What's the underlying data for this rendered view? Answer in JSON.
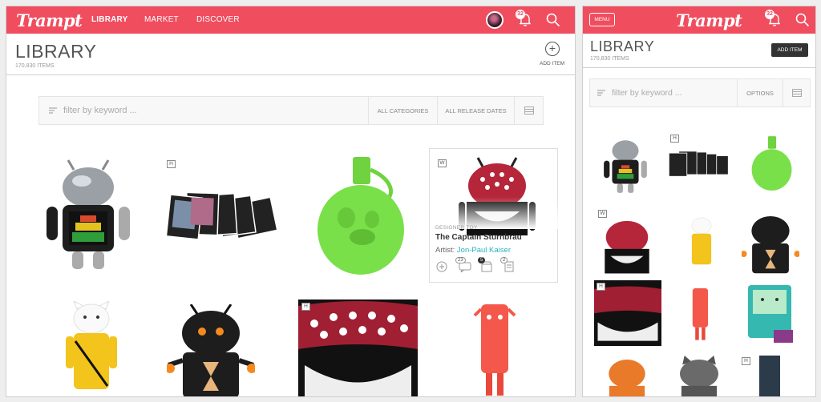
{
  "desktop": {
    "logo": "Trampt",
    "nav": [
      "LIBRARY",
      "MARKET",
      "DISCOVER"
    ],
    "notifications": "32",
    "title": "LIBRARY",
    "count": "170,830 ITEMS",
    "add_item": "ADD ITEM",
    "filter": {
      "placeholder": "filter by keyword ...",
      "categories": "ALL CATEGORIES",
      "dates": "ALL RELEASE DATES"
    },
    "tags": [
      "H",
      "W",
      "H"
    ],
    "card": {
      "category": "DESIGNER TOY",
      "name": "The Captain Sturnbrau",
      "artist_label": "Artist:",
      "artist": "Jon-Paul Kaiser",
      "counts": [
        "23",
        "5",
        "2"
      ]
    }
  },
  "mobile": {
    "menu": "MENU",
    "logo": "Trampt",
    "notifications": "32",
    "title": "LIBRARY",
    "count": "170,830 ITEMS",
    "add_item": "ADD ITEM",
    "filter": {
      "placeholder": "filter by keyword ...",
      "options": "OPTIONS"
    },
    "tags": [
      "H",
      "W",
      "H",
      "H"
    ]
  },
  "colors": {
    "accent": "#f04d5e",
    "link": "#27b5c4"
  }
}
